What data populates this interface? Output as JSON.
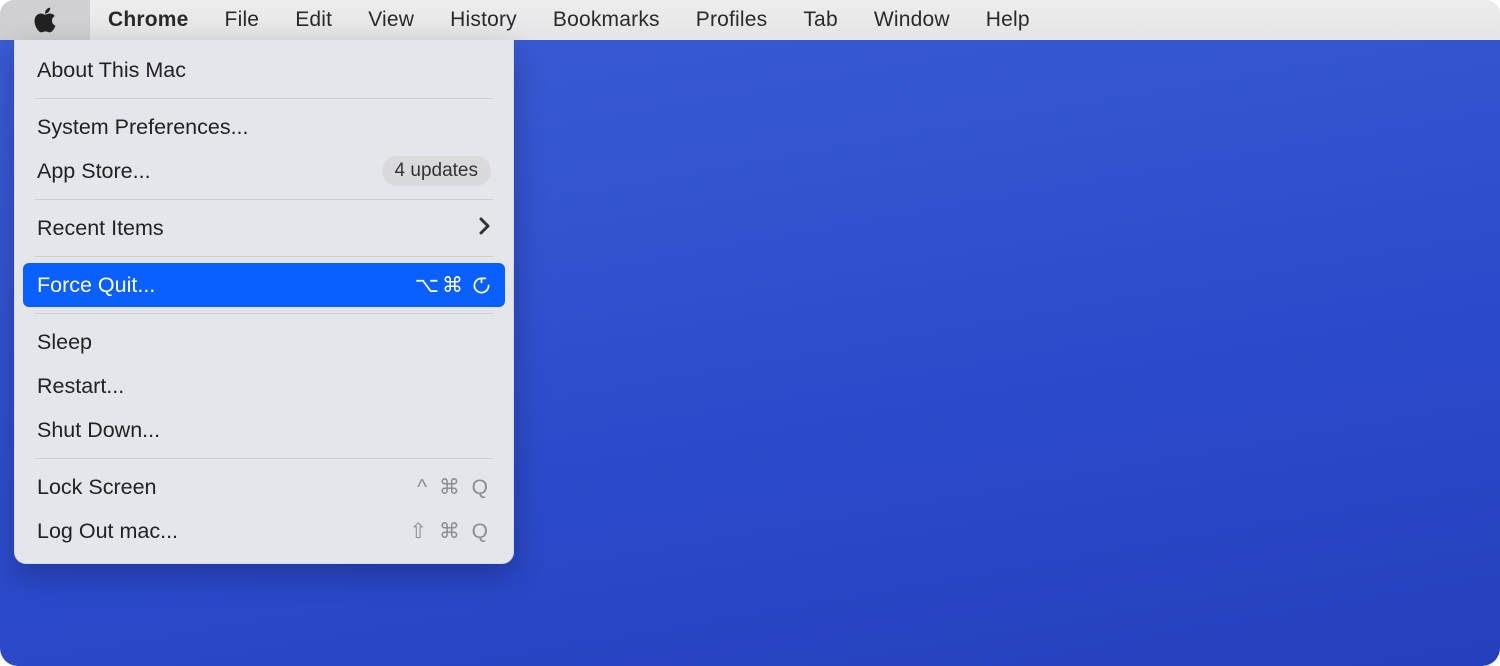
{
  "menubar": {
    "app_name": "Chrome",
    "items": [
      "File",
      "Edit",
      "View",
      "History",
      "Bookmarks",
      "Profiles",
      "Tab",
      "Window",
      "Help"
    ]
  },
  "apple_menu": {
    "about": "About This Mac",
    "system_preferences": "System Preferences...",
    "app_store": "App Store...",
    "app_store_badge": "4 updates",
    "recent_items": "Recent Items",
    "force_quit": "Force Quit...",
    "force_quit_shortcut": "⌥⌘",
    "sleep": "Sleep",
    "restart": "Restart...",
    "shut_down": "Shut Down...",
    "lock_screen": "Lock Screen",
    "lock_screen_shortcut": "^ ⌘ Q",
    "log_out": "Log Out mac...",
    "log_out_shortcut": "⇧ ⌘ Q"
  }
}
